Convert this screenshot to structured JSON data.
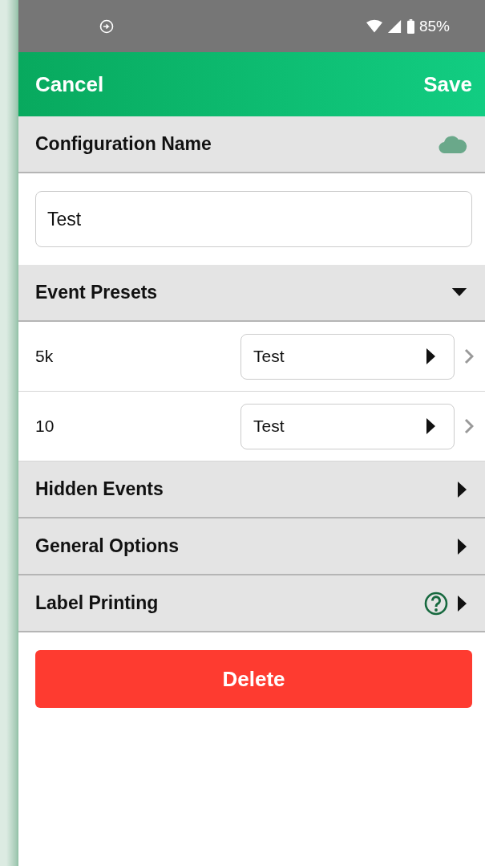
{
  "status_bar": {
    "battery": "85%"
  },
  "header": {
    "cancel": "Cancel",
    "save": "Save"
  },
  "sections": [
    {
      "kind": "name",
      "title": "Configuration Name",
      "value": "Test"
    },
    {
      "kind": "presets",
      "title": "Event Presets",
      "expanded": true,
      "help": false,
      "rows": [
        {
          "label": "5k",
          "value": "Test"
        },
        {
          "label": "10",
          "value": "Test"
        }
      ]
    },
    {
      "kind": "plain",
      "title": "Hidden Events",
      "expanded": false,
      "help": false
    },
    {
      "kind": "plain",
      "title": "General Options",
      "expanded": false,
      "help": false
    },
    {
      "kind": "plain",
      "title": "Label Printing",
      "expanded": false,
      "help": true
    }
  ],
  "delete_button": "Delete"
}
